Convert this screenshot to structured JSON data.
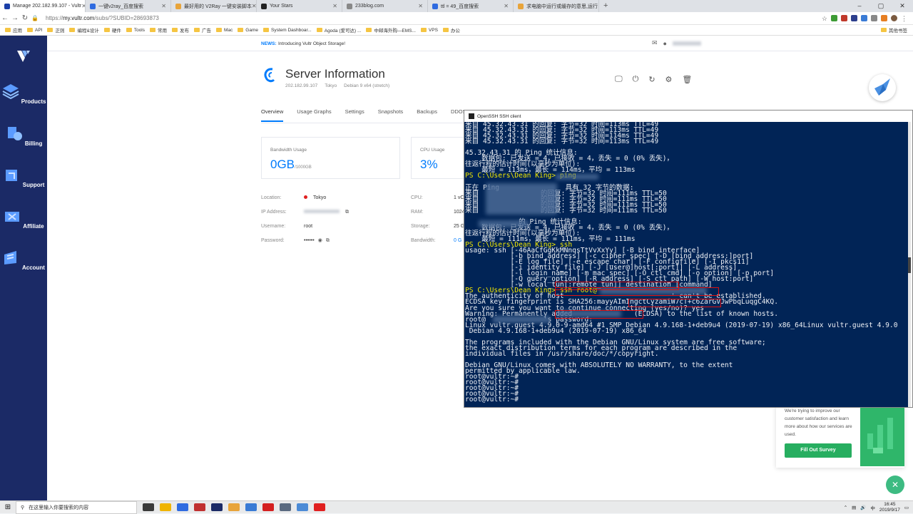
{
  "browser": {
    "tabs": [
      {
        "label": "Manage 202.182.99.107 - Vultr",
        "color": "#1b3fa8",
        "active": true
      },
      {
        "label": "一键v2ray_百度搜索",
        "color": "#2f6be0"
      },
      {
        "label": "最好用的 V2Ray 一键安装脚本",
        "color": "#e8a43a"
      },
      {
        "label": "Your Stars",
        "color": "#222222"
      },
      {
        "label": "233blog.com",
        "color": "#888888"
      },
      {
        "label": "ttl = 49_百度搜索",
        "color": "#2f6be0"
      },
      {
        "label": "求电脑中运行或缓存的意思,运行",
        "color": "#e8a43a"
      }
    ],
    "new_tab": "+",
    "url_scheme": "https://",
    "url_host": "my.vultr.com",
    "url_path": "/subs/?SUBID=28693873",
    "win_controls": [
      "–",
      "▢",
      "✕"
    ],
    "bookmarks": [
      "应用",
      "API",
      "正则",
      "编程&设计",
      "硬件",
      "Tools",
      "常用",
      "发布",
      "广告",
      "Mac",
      "Game",
      "System Dashboar...",
      "Agoda (爱可达) ...",
      "中邮海外购—EMS...",
      "VPS",
      "办公"
    ],
    "bookmarks_other": "其他书签"
  },
  "sidebar": {
    "items": [
      {
        "label": "Products"
      },
      {
        "label": "Billing"
      },
      {
        "label": "Support"
      },
      {
        "label": "Affiliate"
      },
      {
        "label": "Account"
      }
    ]
  },
  "news": {
    "label": "NEWS:",
    "text": "Introducing Vultr Object Storage!"
  },
  "server": {
    "title": "Server Information",
    "ip": "202.182.99.107",
    "location": "Tokyo",
    "os": "Debian 9 x64 (stretch)"
  },
  "tabs": [
    "Overview",
    "Usage Graphs",
    "Settings",
    "Snapshots",
    "Backups",
    "DDOS"
  ],
  "cards": {
    "bandwidth_label": "Bandwidth Usage",
    "bandwidth_value": "0GB",
    "bandwidth_unit": "/1000GB",
    "cpu_label": "CPU Usage",
    "cpu_value": "3%"
  },
  "details": {
    "location_label": "Location:",
    "location_value": "Tokyo",
    "ip_label": "IP Address:",
    "username_label": "Username:",
    "username_value": "root",
    "password_label": "Password:",
    "password_value": "••••••",
    "cpu_label": "CPU:",
    "cpu_value": "1 vC",
    "ram_label": "RAM:",
    "ram_value": "1024",
    "storage_label": "Storage:",
    "storage_value": "25 G",
    "bandwidth_label": "Bandwidth:",
    "bandwidth_value": "0 G"
  },
  "survey": {
    "text": "We're trying to improve our customer satisfaction and learn more about how our services are used.",
    "button": "Fill Out Survey"
  },
  "terminal": {
    "title": "OpenSSH SSH client",
    "lines": [
      {
        "t": "来自 45.32.43.31 的回复: 字节=32 时间=113ms TTL=49"
      },
      {
        "t": "来自 45.32.43.31 的回复: 字节=32 时间=113ms TTL=49"
      },
      {
        "t": "来自 45.32.43.31 的回复: 字节=32 时间=114ms TTL=49"
      },
      {
        "t": "来自 45.32.43.31 的回复: 字节=32 时间=113ms TTL=49"
      },
      {
        "t": ""
      },
      {
        "t": "45.32.43.31 的 Ping 统计信息:"
      },
      {
        "t": "    数据包: 已发送 = 4，已接收 = 4，丢失 = 0 (0% 丢失)，"
      },
      {
        "t": "往返行程的估计时间(以毫秒为单位):"
      },
      {
        "t": "    最短 = 113ms，最长 = 114ms，平均 = 113ms"
      },
      {
        "t": "PS C:\\Users\\Dean King> ping",
        "y": true
      },
      {
        "t": ""
      },
      {
        "t": "正在 Ping                具有 32 字节的数据:"
      },
      {
        "t": "来自               的回复: 字节=32 时间=111ms TTL=50"
      },
      {
        "t": "来自               的回复: 字节=32 时间=111ms TTL=50"
      },
      {
        "t": "来自               的回复: 字节=32 时间=111ms TTL=50"
      },
      {
        "t": "来自               的回复: 字节=32 时间=111ms TTL=50"
      },
      {
        "t": ""
      },
      {
        "t": "             的 Ping 统计信息:"
      },
      {
        "t": "    数据包: 已发送 = 4，已接收 = 4，丢失 = 0 (0% 丢失)，"
      },
      {
        "t": "往返行程的估计时间(以毫秒为单位):"
      },
      {
        "t": "    最短 = 111ms，最长 = 111ms，平均 = 111ms"
      },
      {
        "t": "PS C:\\Users\\Dean King> ssh",
        "y": true
      },
      {
        "t": "usage: ssh [-46AaCfGgKkMNnqsTtVvXxYy] [-B bind_interface]"
      },
      {
        "t": "           [-b bind_address] [-c cipher_spec] [-D [bind_address:]port]"
      },
      {
        "t": "           [-E log_file] [-e escape_char] [-F configfile] [-I pkcs11]"
      },
      {
        "t": "           [-i identity_file] [-J [user@]host[:port]] [-L address]"
      },
      {
        "t": "           [-l login_name] [-m mac_spec] [-O ctl_cmd] [-o option] [-p port]"
      },
      {
        "t": "           [-Q query_option] [-R address] [-S ctl_path] [-W host:port]"
      },
      {
        "t": "           [-w local_tun[:remote_tun]] destination [command]"
      },
      {
        "t": "PS C:\\Users\\Dean King> ssh root@",
        "y": true
      },
      {
        "t": "The authenticity of host                          ' can't be established."
      },
      {
        "t": "ECDSA key fingerprint is SHA256:mayyAImIngctCyzamiW7cT+c6ZarGVJwPbqLuqgC4KQ."
      },
      {
        "t": "Are you sure you want to continue connecting (yes/no)? yes"
      },
      {
        "t": "Warning: Permanently added               (ECDSA) to the list of known hosts."
      },
      {
        "t": "root@              's password:"
      },
      {
        "t": "Linux vultr.guest 4.9.0-9-amd64 #1 SMP Debian 4.9.168-1+deb9u4 (2019-07-19) x86_64Linux vultr.guest 4.9.0"
      },
      {
        "t": " Debian 4.9.168-1+deb9u4 (2019-07-19) x86_64"
      },
      {
        "t": ""
      },
      {
        "t": "The programs included with the Debian GNU/Linux system are free software;"
      },
      {
        "t": "the exact distribution terms for each program are described in the"
      },
      {
        "t": "individual files in /usr/share/doc/*/copyright."
      },
      {
        "t": ""
      },
      {
        "t": "Debian GNU/Linux comes with ABSOLUTELY NO WARRANTY, to the extent"
      },
      {
        "t": "permitted by applicable law."
      },
      {
        "t": "root@vultr:~#"
      },
      {
        "t": "root@vultr:~#"
      },
      {
        "t": "root@vultr:~#"
      },
      {
        "t": "root@vultr:~#"
      },
      {
        "t": "root@vultr:~#"
      }
    ]
  },
  "taskbar": {
    "search_placeholder": "在这里输入你要搜索的内容",
    "time": "16:45",
    "date": "2019/9/17",
    "lang": "中",
    "apps": [
      "#3a3a3a",
      "#f0b400",
      "#2f6be0",
      "#c03030",
      "#1b2a66",
      "#e8a43a",
      "#3a7bd5",
      "#d42020",
      "#5a6a80",
      "#4c8bd6",
      "#e02020"
    ]
  },
  "colors": {
    "accent": "#007bfc",
    "sidebar": "#1b2a66",
    "terminal_bg": "#012456",
    "survey_green": "#27ae60"
  }
}
